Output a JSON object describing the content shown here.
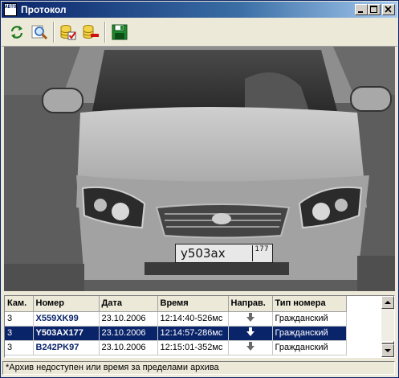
{
  "window": {
    "title": "Протокол",
    "app_icon_text": "АВТО"
  },
  "titlebar_buttons": [
    {
      "name": "minimize-button",
      "icon": "minimize-icon"
    },
    {
      "name": "maximize-button",
      "icon": "maximize-icon"
    },
    {
      "name": "close-button",
      "icon": "close-icon"
    }
  ],
  "toolbar": [
    {
      "name": "refresh-button",
      "icon": "refresh-icon"
    },
    {
      "name": "search-button",
      "icon": "magnifier-icon"
    },
    {
      "name": "db-select-button",
      "icon": "database-check-icon"
    },
    {
      "name": "db-remove-button",
      "icon": "database-remove-icon"
    },
    {
      "name": "save-button",
      "icon": "floppy-disk-icon"
    }
  ],
  "viewer": {
    "plate_number": "у503ах",
    "plate_region": "177"
  },
  "table": {
    "columns": [
      "Кам.",
      "Номер",
      "Дата",
      "Время",
      "Направ.",
      "Тип номера"
    ],
    "rows": [
      {
        "cam": "3",
        "number": "X559XK99",
        "date": "23.10.2006",
        "time": "12:14:40-526мс",
        "direction": "down-arrow-icon",
        "type": "Гражданский",
        "selected": false
      },
      {
        "cam": "3",
        "number": "Y503AX177",
        "date": "23.10.2006",
        "time": "12:14:57-286мс",
        "direction": "down-arrow-icon",
        "type": "Гражданский",
        "selected": true
      },
      {
        "cam": "3",
        "number": "B242PK97",
        "date": "23.10.2006",
        "time": "12:15:01-352мс",
        "direction": "down-arrow-icon",
        "type": "Гражданский",
        "selected": false
      }
    ]
  },
  "status": {
    "text": "*Архив недоступен или время за пределами архива"
  },
  "colors": {
    "title_gradient_start": "#0a246a",
    "selection": "#0a246a",
    "window_bg": "#ece9d8"
  }
}
